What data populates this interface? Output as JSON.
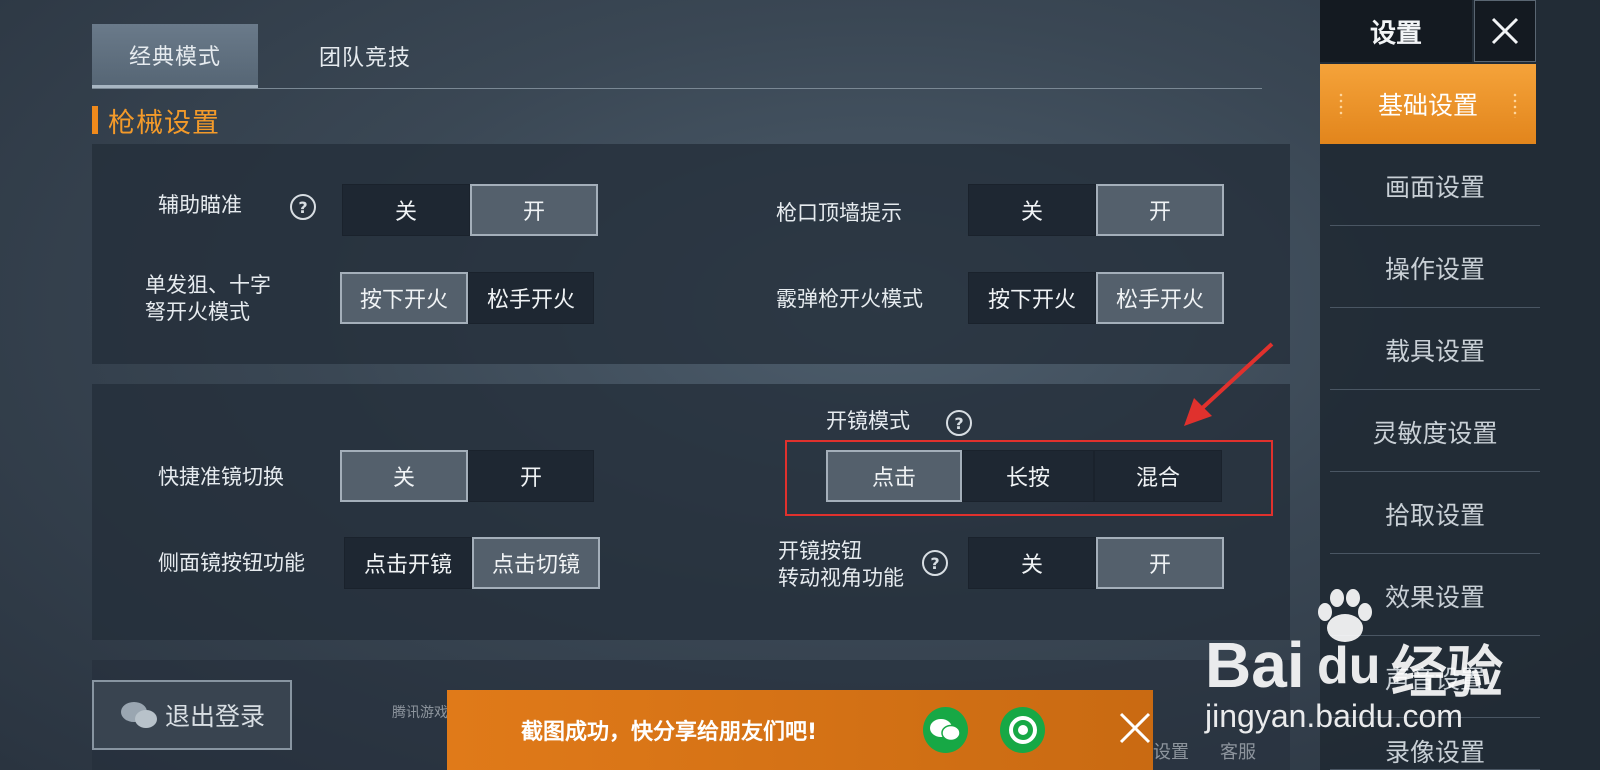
{
  "tabs": [
    {
      "label": "经典模式",
      "active": true
    },
    {
      "label": "团队竞技",
      "active": false
    }
  ],
  "section": {
    "title": "枪械设置"
  },
  "gun_panel": {
    "assist_aim": {
      "label": "辅助瞄准",
      "options": [
        "关",
        "开"
      ],
      "selected": "开"
    },
    "muzzle_wall": {
      "label": "枪口顶墙提示",
      "options": [
        "关",
        "开"
      ],
      "selected": "开"
    },
    "sniper_fire": {
      "label_line1": "单发狙、十字",
      "label_line2": "弩开火模式",
      "options": [
        "按下开火",
        "松手开火"
      ],
      "selected": "按下开火"
    },
    "shotgun_fire": {
      "label": "霰弹枪开火模式",
      "options": [
        "按下开火",
        "松手开火"
      ],
      "selected": "松手开火"
    }
  },
  "scope_panel": {
    "scope_mode": {
      "label": "开镜模式",
      "options": [
        "点击",
        "长按",
        "混合"
      ],
      "selected": "点击"
    },
    "quick_scope": {
      "label": "快捷准镜切换",
      "options": [
        "关",
        "开"
      ],
      "selected": "关"
    },
    "side_scope": {
      "label": "侧面镜按钮功能",
      "options": [
        "点击开镜",
        "点击切镜"
      ],
      "selected": "点击切镜"
    },
    "scope_turn": {
      "label_line1": "开镜按钮",
      "label_line2": "转动视角功能",
      "options": [
        "关",
        "开"
      ],
      "selected": "开"
    }
  },
  "sidebar": {
    "title": "设置",
    "items": [
      {
        "label": "基础设置",
        "active": true
      },
      {
        "label": "画面设置"
      },
      {
        "label": "操作设置"
      },
      {
        "label": "载具设置"
      },
      {
        "label": "灵敏度设置"
      },
      {
        "label": "拾取设置"
      },
      {
        "label": "效果设置"
      },
      {
        "label": "声音设置"
      },
      {
        "label": "录像设置"
      }
    ]
  },
  "bottom": {
    "logout_label": "退出登录",
    "faint_left": "腾讯游戏",
    "faint_settings": "设置",
    "faint_service": "客服"
  },
  "toast": {
    "text": "截图成功，快分享给朋友们吧!"
  },
  "watermark": {
    "brand": "Bai",
    "brand2": "du",
    "cn": "经验",
    "url": "jingyan.baidu.com"
  },
  "colors": {
    "accent": "#f08a1c",
    "highlight": "#e0312d",
    "share_green": "#17a845"
  }
}
